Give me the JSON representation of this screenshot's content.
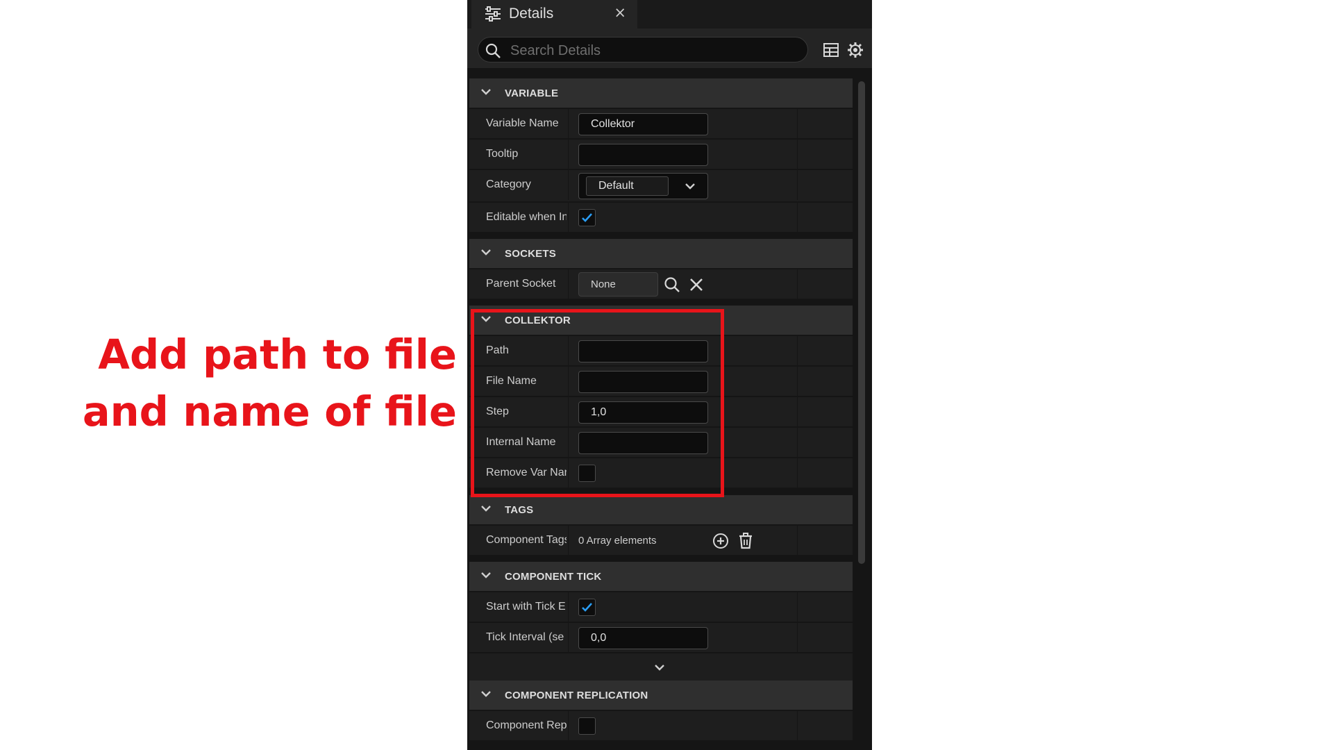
{
  "annotation": {
    "lines": [
      "Add path to file",
      "and name of file"
    ],
    "color": "#e8141a"
  },
  "tab": {
    "title": "Details",
    "icon": "details-sliders-icon",
    "close": "×"
  },
  "search": {
    "placeholder": "Search Details"
  },
  "toolbar": {
    "icons": [
      "table-view-icon",
      "settings-gear-icon"
    ]
  },
  "sections": {
    "variable": {
      "title": "VARIABLE",
      "variable_name": {
        "label": "Variable Name",
        "value": "Collektor"
      },
      "tooltip": {
        "label": "Tooltip",
        "value": ""
      },
      "category": {
        "label": "Category",
        "value": "Default"
      },
      "editable": {
        "label": "Editable when In",
        "checked": true
      }
    },
    "sockets": {
      "title": "SOCKETS",
      "parent_socket": {
        "label": "Parent Socket",
        "value": "None"
      }
    },
    "collektor": {
      "title": "COLLEKTOR",
      "path": {
        "label": "Path",
        "value": ""
      },
      "file_name": {
        "label": "File Name",
        "value": ""
      },
      "step": {
        "label": "Step",
        "value": "1,0"
      },
      "internal_name": {
        "label": "Internal Name",
        "value": ""
      },
      "remove_var": {
        "label": "Remove Var Nar",
        "checked": false
      }
    },
    "tags": {
      "title": "TAGS",
      "component_tags": {
        "label": "Component Tags",
        "value": "0 Array elements"
      }
    },
    "component_tick": {
      "title": "COMPONENT TICK",
      "start_with_tick": {
        "label": "Start with Tick E",
        "checked": true
      },
      "tick_interval": {
        "label": "Tick Interval (se",
        "value": "0,0"
      }
    },
    "component_replication": {
      "title": "COMPONENT REPLICATION",
      "component_repl": {
        "label": "Component Repl",
        "checked": false
      }
    }
  },
  "colors": {
    "accent_check": "#2a9df4",
    "panel_bg": "#151515",
    "section_bg": "#2f2f2f",
    "row_bg": "#1e1e1e"
  }
}
